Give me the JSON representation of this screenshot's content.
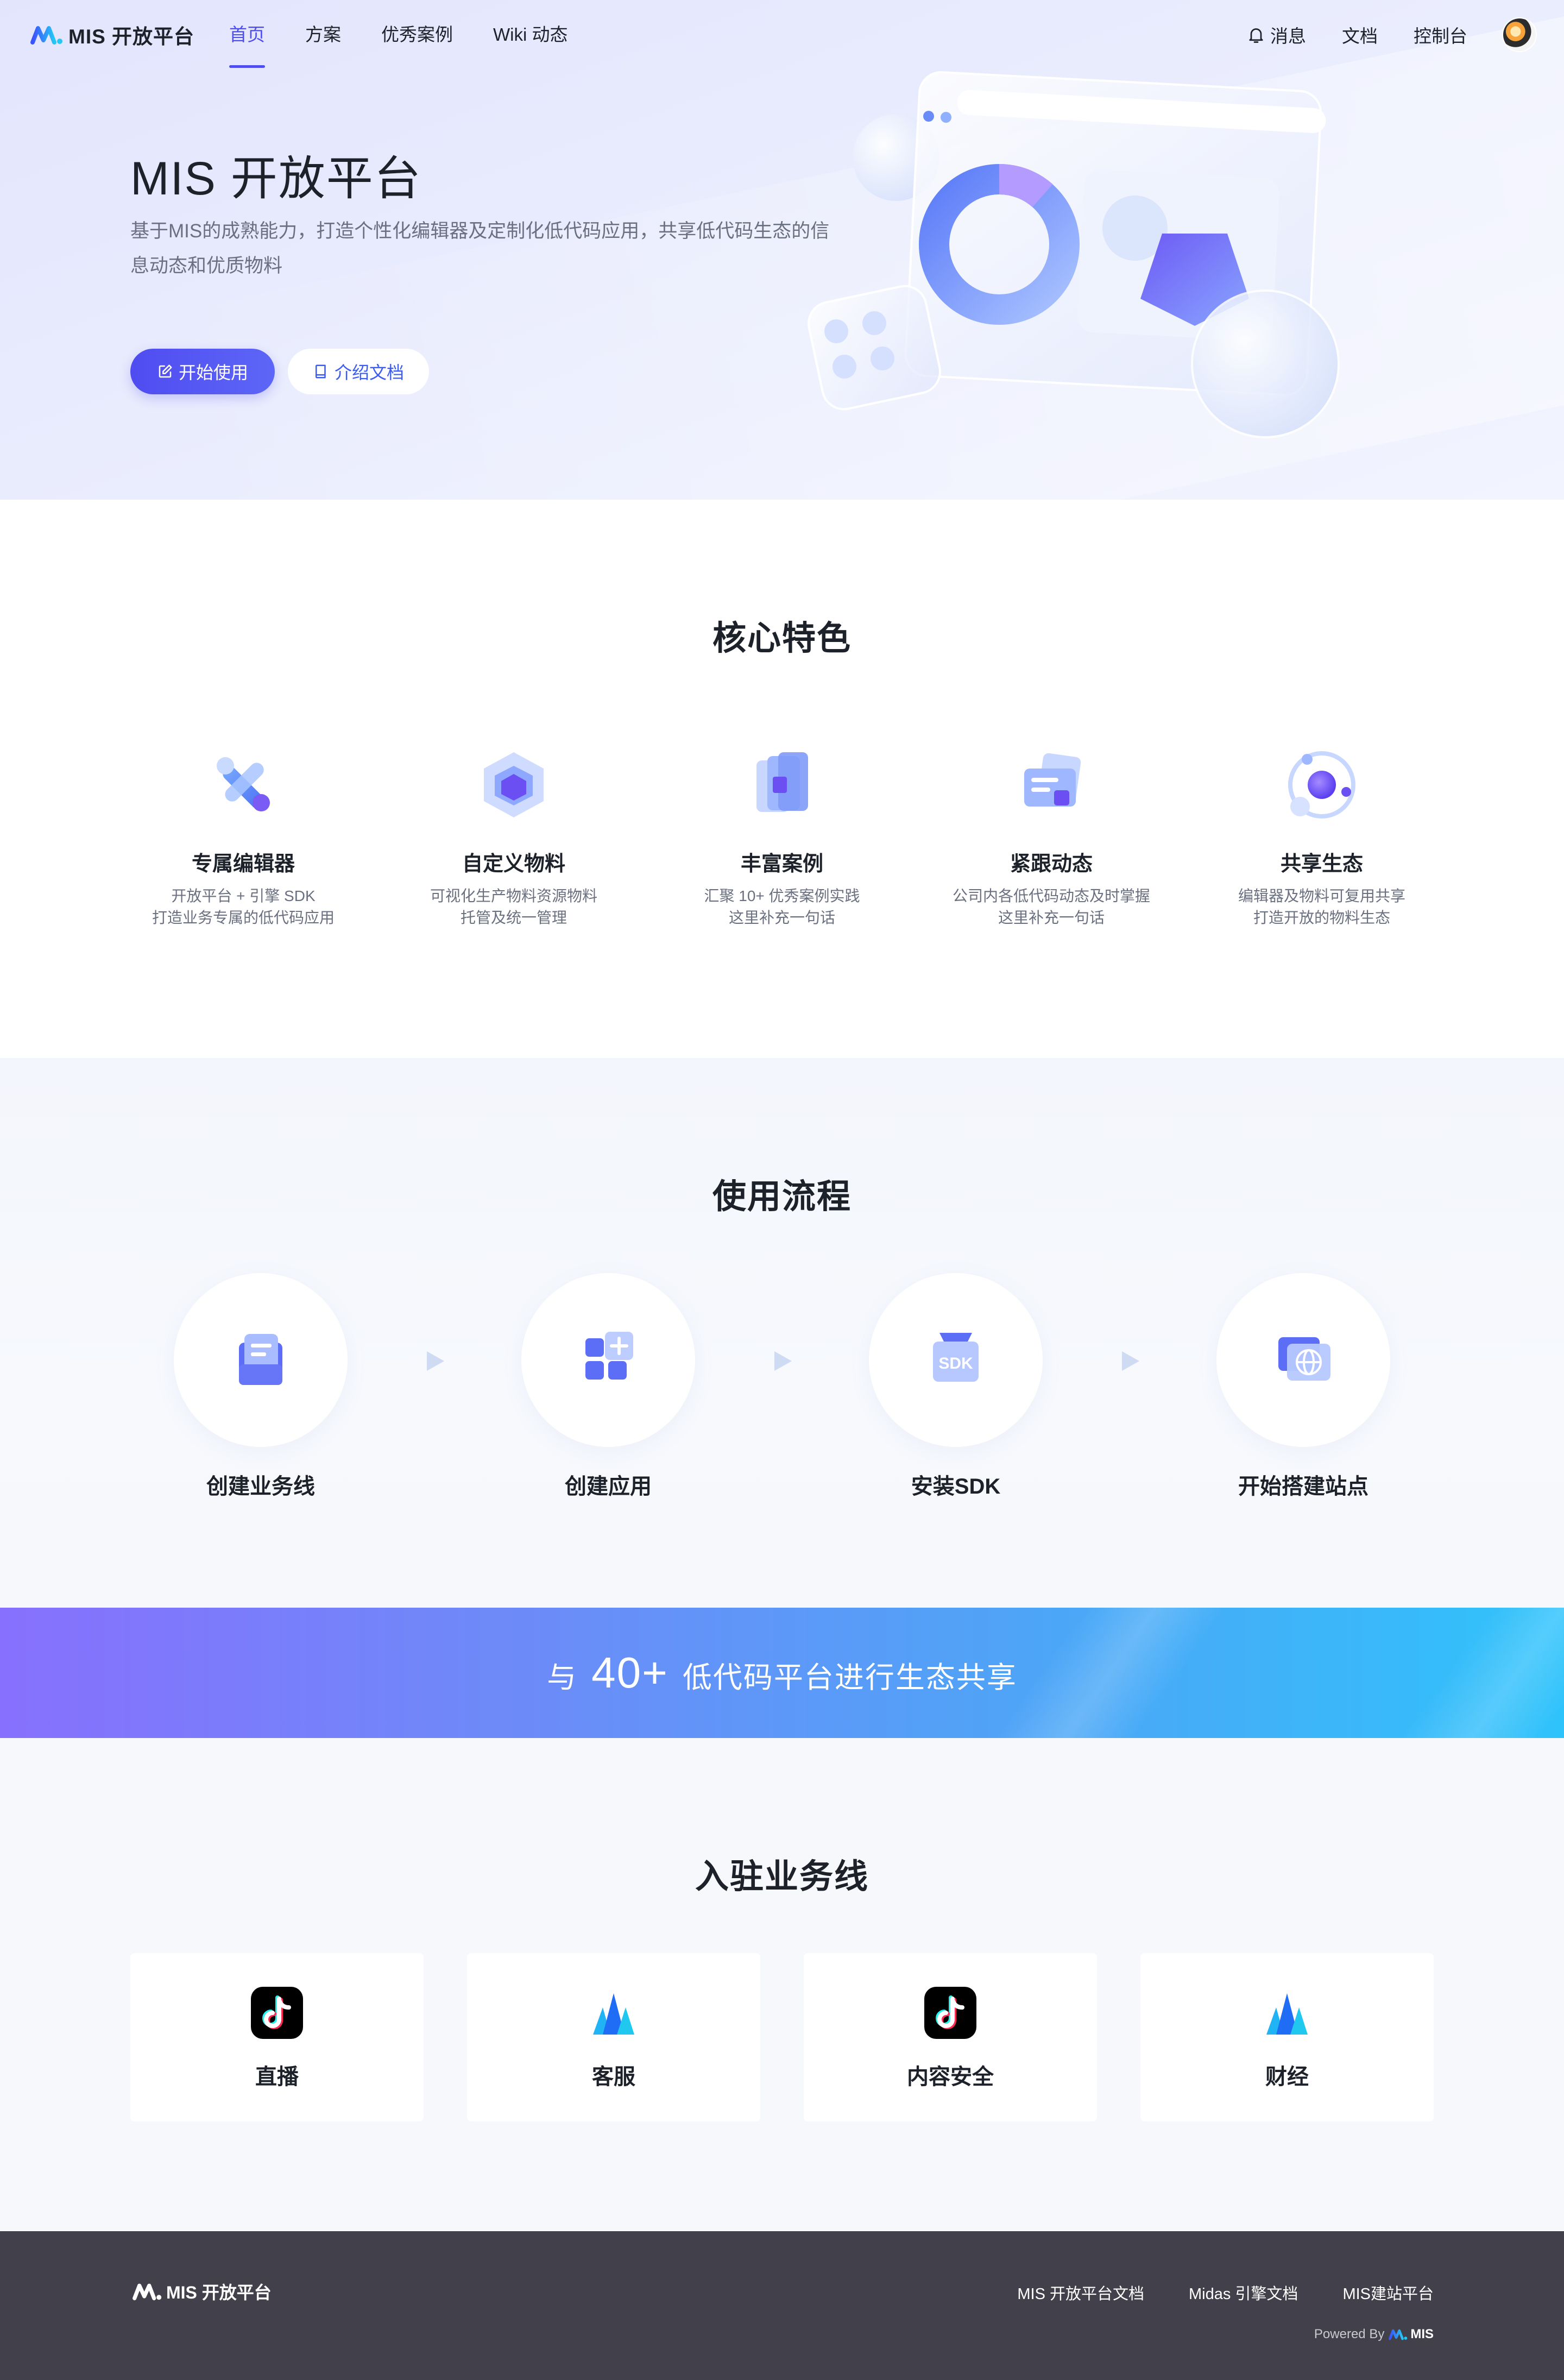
{
  "nav": {
    "logo_text": "MIS 开放平台",
    "items": [
      "首页",
      "方案",
      "优秀案例",
      "Wiki 动态"
    ],
    "right": {
      "messages": "消息",
      "docs": "文档",
      "console": "控制台"
    }
  },
  "hero": {
    "title": "MIS 开放平台",
    "desc": "基于MIS的成熟能力，打造个性化编辑器及定制化低代码应用，共享低代码生态的信息动态和优质物料",
    "start_button": "开始使用",
    "docs_button": "介绍文档"
  },
  "features": {
    "title": "核心特色",
    "items": [
      {
        "name": "专属编辑器",
        "desc1": "开放平台 + 引擎 SDK",
        "desc2": "打造业务专属的低代码应用",
        "icon": "wrench-icon"
      },
      {
        "name": "自定义物料",
        "desc1": "可视化生产物料资源物料",
        "desc2": "托管及统一管理",
        "icon": "cube-icon"
      },
      {
        "name": "丰富案例",
        "desc1": "汇聚 10+ 优秀案例实践",
        "desc2": "这里补充一句话",
        "icon": "stack-icon"
      },
      {
        "name": "紧跟动态",
        "desc1": "公司内各低代码动态及时掌握",
        "desc2": "这里补充一句话",
        "icon": "cards-icon"
      },
      {
        "name": "共享生态",
        "desc1": "编辑器及物料可复用共享",
        "desc2": "打造开放的物料生态",
        "icon": "orbit-icon"
      }
    ]
  },
  "flow": {
    "title": "使用流程",
    "steps": [
      {
        "name": "创建业务线",
        "icon": "document-icon"
      },
      {
        "name": "创建应用",
        "icon": "app-grid-icon"
      },
      {
        "name": "安装SDK",
        "icon": "sdk-icon"
      },
      {
        "name": "开始搭建站点",
        "icon": "globe-icon"
      }
    ]
  },
  "banner": {
    "prefix": "与",
    "number": "40+",
    "suffix": "低代码平台进行生态共享"
  },
  "business": {
    "title": "入驻业务线",
    "cards": [
      {
        "name": "直播",
        "icon": "tiktok-icon"
      },
      {
        "name": "客服",
        "icon": "mountain-icon"
      },
      {
        "name": "内容安全",
        "icon": "tiktok-icon"
      },
      {
        "name": "财经",
        "icon": "mountain-icon"
      }
    ]
  },
  "footer": {
    "logo_text": "MIS 开放平台",
    "links": [
      "MIS 开放平台文档",
      "Midas 引擎文档",
      "MIS建站平台"
    ],
    "powered_by": "Powered By",
    "powered_brand": "MIS"
  },
  "colors": {
    "primary": "#4e4ef0",
    "link": "#3a5cf2",
    "footer_bg": "#42414b",
    "banner_start": "#8770fd",
    "banner_end": "#2fc3fb"
  }
}
